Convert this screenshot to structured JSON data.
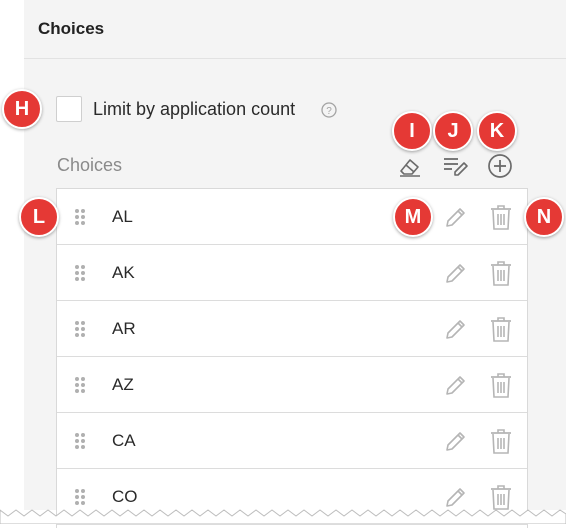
{
  "panel": {
    "title": "Choices"
  },
  "limit": {
    "label": "Limit by application count",
    "checked": false
  },
  "choices_header": {
    "label": "Choices"
  },
  "toolbar": [
    {
      "name": "clear-icon"
    },
    {
      "name": "bulk-edit-icon"
    },
    {
      "name": "add-choice-icon"
    }
  ],
  "choices": [
    {
      "label": "AL"
    },
    {
      "label": "AK"
    },
    {
      "label": "AR"
    },
    {
      "label": "AZ"
    },
    {
      "label": "CA"
    },
    {
      "label": "CO"
    }
  ],
  "callouts": {
    "h": "H",
    "i": "I",
    "j": "J",
    "k": "K",
    "l": "L",
    "m": "M",
    "n": "N"
  },
  "colors": {
    "callout": "#e53935",
    "panel_bg": "#f4f4f4",
    "icon": "#6b6b6b",
    "row_icon": "#b5b5b5"
  }
}
